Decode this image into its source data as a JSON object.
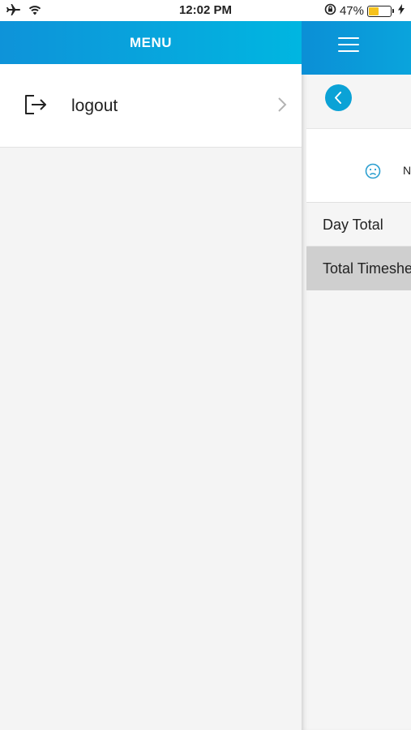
{
  "status_bar": {
    "time": "12:02 PM",
    "battery_percent": "47%",
    "battery_level": 0.47,
    "icons": [
      "airplane-icon",
      "wifi-icon",
      "orientation-lock-icon",
      "battery-icon",
      "charging-icon"
    ]
  },
  "drawer": {
    "title": "MENU",
    "items": [
      {
        "label": "logout",
        "icon": "logout-icon"
      }
    ]
  },
  "main": {
    "header_icon": "hamburger-icon",
    "back_icon": "back-icon",
    "empty_icon": "sad-face-icon",
    "empty_text": "N",
    "rows": [
      {
        "label": "Day Total"
      },
      {
        "label": "Total Timeshe"
      }
    ]
  },
  "colors": {
    "accent": "#0aa4dc",
    "header_start": "#0e93d9",
    "header_end": "#00b6e1",
    "battery": "#f6c21c",
    "selected_row": "#cfcfcf"
  }
}
